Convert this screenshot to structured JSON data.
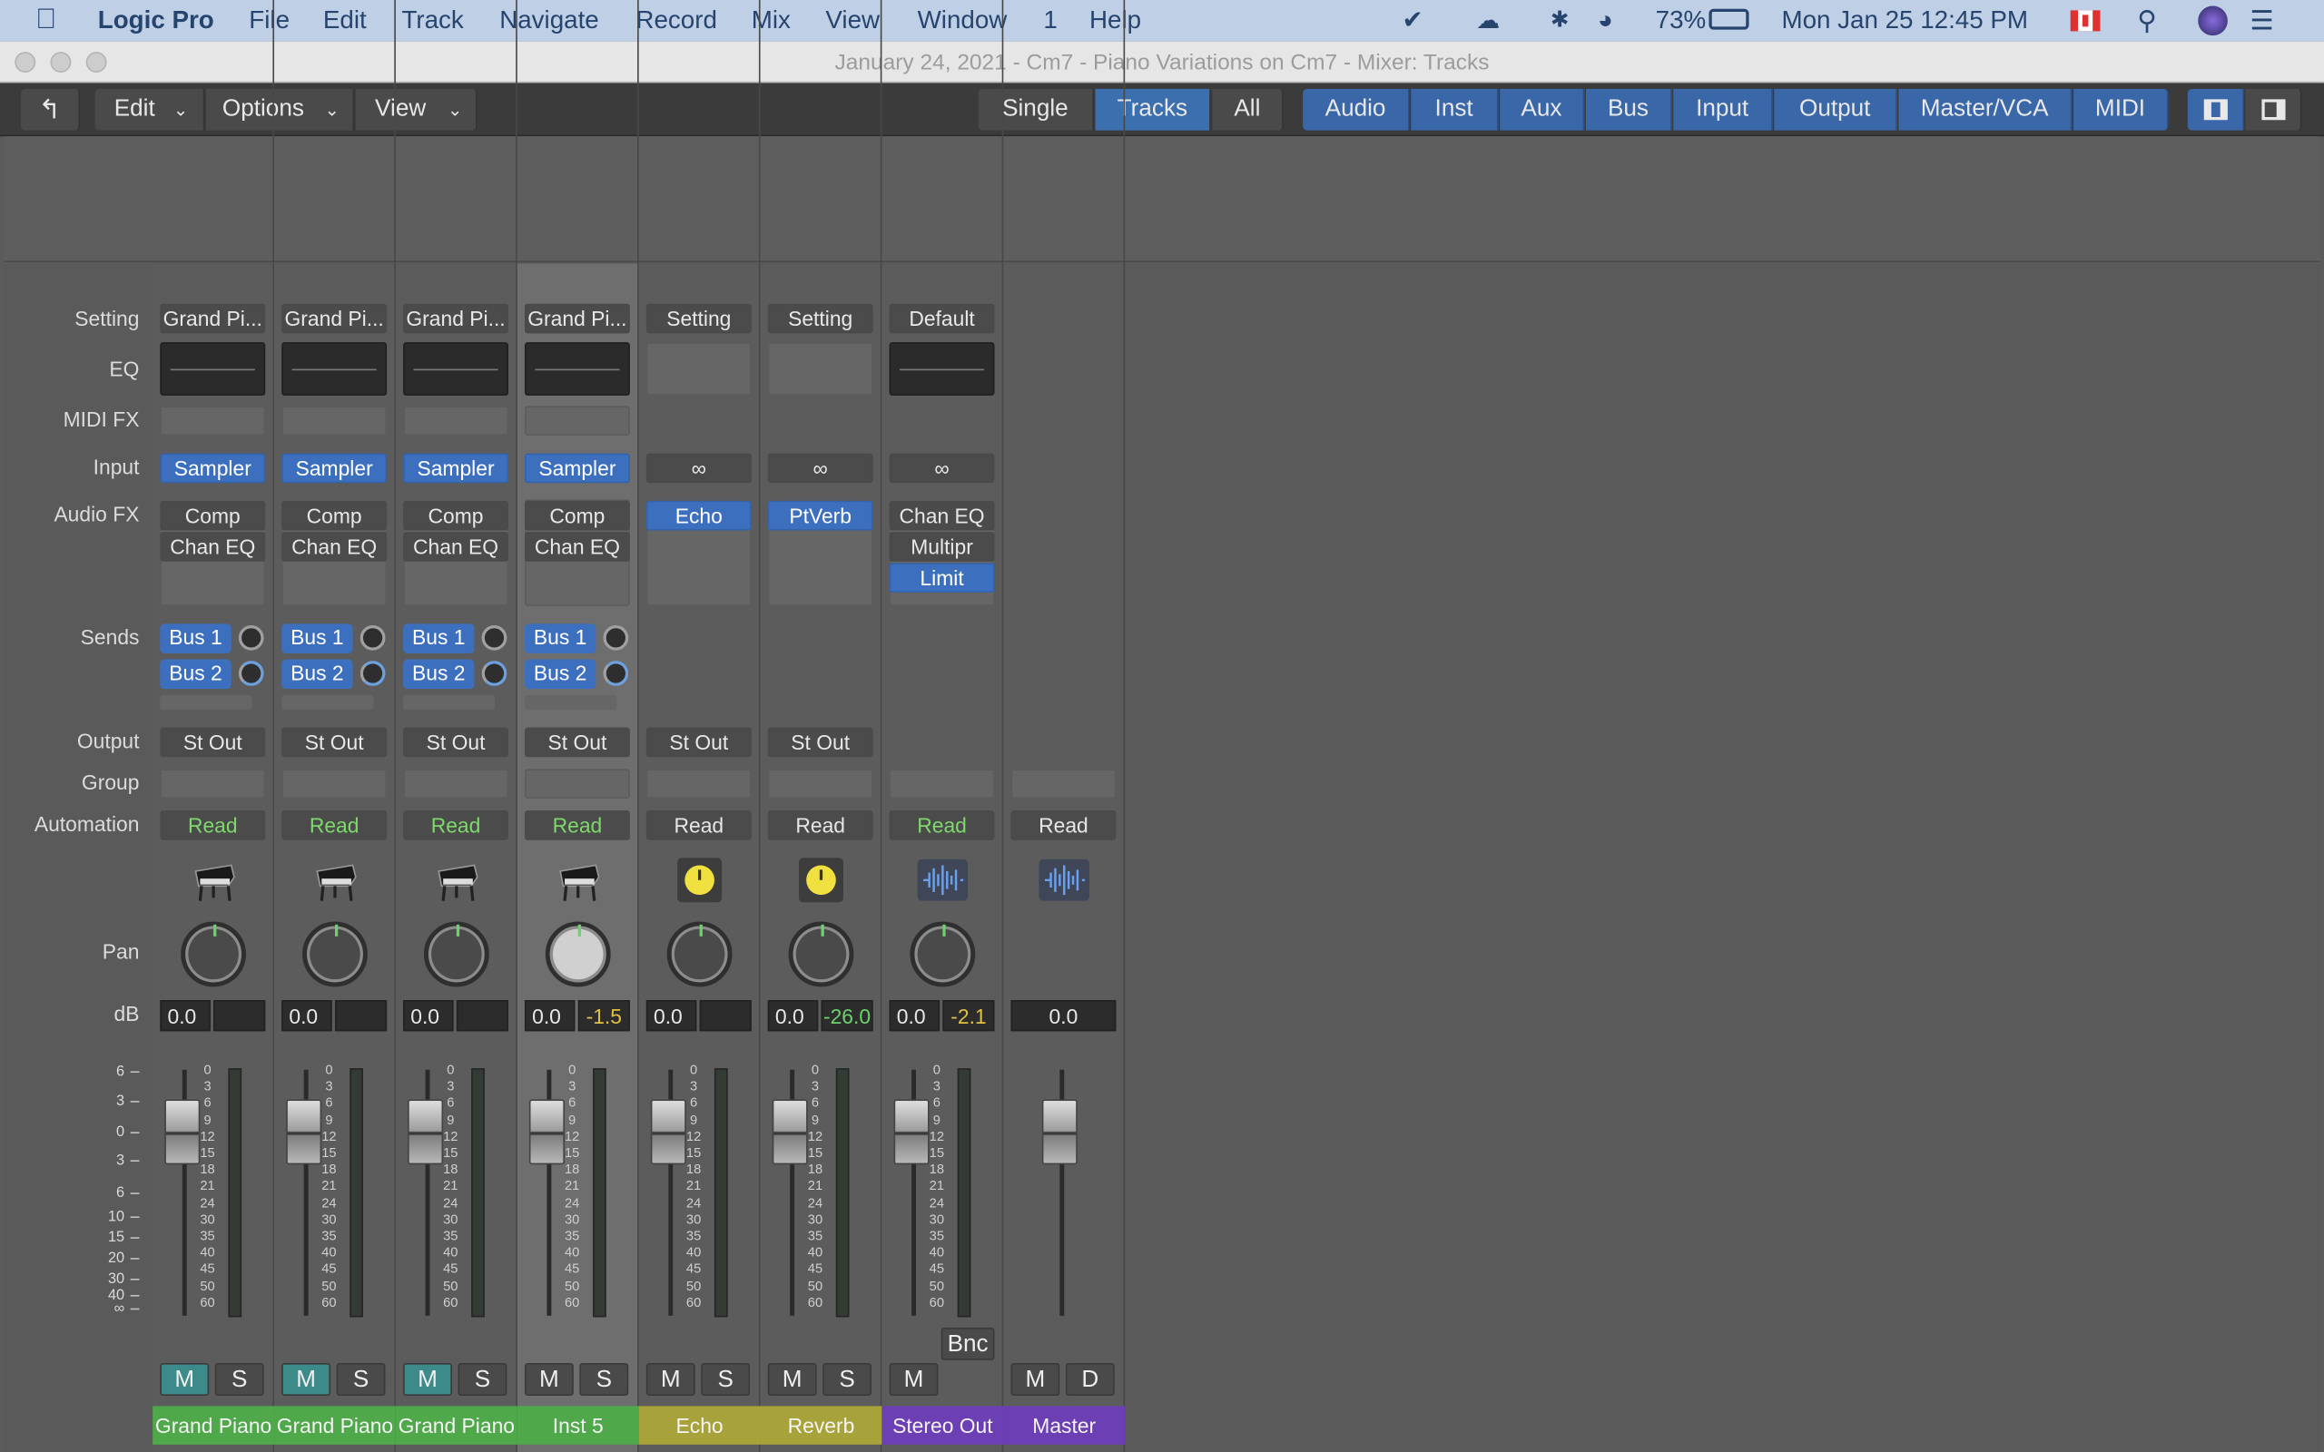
{
  "menubar": {
    "app": "Logic Pro",
    "items": [
      "File",
      "Edit",
      "Track",
      "Navigate",
      "Record",
      "Mix",
      "View",
      "Window",
      "1",
      "Help"
    ],
    "battery": "73%",
    "datetime": "Mon Jan 25  12:45 PM"
  },
  "window": {
    "title": "January 24, 2021 - Cm7 - Piano Variations on Cm7 - Mixer: Tracks"
  },
  "toolbar": {
    "menus": [
      "Edit",
      "Options",
      "View"
    ],
    "view_modes": [
      "Single",
      "Tracks",
      "All"
    ],
    "selected_view": "Tracks",
    "filters": [
      "Audio",
      "Inst",
      "Aux",
      "Bus",
      "Input",
      "Output",
      "Master/VCA",
      "MIDI"
    ]
  },
  "row_labels": {
    "setting": "Setting",
    "eq": "EQ",
    "midifx": "MIDI FX",
    "input": "Input",
    "audiofx": "Audio FX",
    "sends": "Sends",
    "output": "Output",
    "group": "Group",
    "automation": "Automation",
    "pan": "Pan",
    "db": "dB"
  },
  "scale_left": [
    "6",
    "3",
    "0",
    "3",
    "6",
    "10",
    "15",
    "20",
    "30",
    "40",
    "∞"
  ],
  "scale_meter": [
    "0",
    "3",
    "6",
    "9",
    "12",
    "15",
    "18",
    "21",
    "24",
    "30",
    "35",
    "40",
    "45",
    "50",
    "60"
  ],
  "strips": [
    {
      "name": "Grand Piano",
      "setting": "Grand Pi...",
      "input": "Sampler",
      "fx": [
        "Comp",
        "Chan EQ"
      ],
      "sends": [
        "Bus 1",
        "Bus 2"
      ],
      "output": "St Out",
      "automation": "Read",
      "volume": "0.0",
      "peak": "",
      "mute": "M",
      "solo": "S",
      "mute_on": true,
      "color": "#4fa84a",
      "icon": "piano-icon"
    },
    {
      "name": "Grand Piano",
      "setting": "Grand Pi...",
      "input": "Sampler",
      "fx": [
        "Comp",
        "Chan EQ"
      ],
      "sends": [
        "Bus 1",
        "Bus 2"
      ],
      "output": "St Out",
      "automation": "Read",
      "volume": "0.0",
      "peak": "",
      "mute": "M",
      "solo": "S",
      "mute_on": true,
      "color": "#4fa84a",
      "icon": "piano-icon"
    },
    {
      "name": "Grand Piano",
      "setting": "Grand Pi...",
      "input": "Sampler",
      "fx": [
        "Comp",
        "Chan EQ"
      ],
      "sends": [
        "Bus 1",
        "Bus 2"
      ],
      "output": "St Out",
      "automation": "Read",
      "volume": "0.0",
      "peak": "",
      "mute": "M",
      "solo": "S",
      "mute_on": true,
      "color": "#4fa84a",
      "icon": "piano-icon"
    },
    {
      "name": "Inst 5",
      "setting": "Grand Pi...",
      "input": "Sampler",
      "fx": [
        "Comp",
        "Chan EQ"
      ],
      "sends": [
        "Bus 1",
        "Bus 2"
      ],
      "output": "St Out",
      "automation": "Read",
      "volume": "0.0",
      "peak": "-1.5",
      "mute": "M",
      "solo": "S",
      "mute_on": false,
      "color": "#4fa84a",
      "icon": "piano-icon"
    },
    {
      "name": "Echo",
      "setting": "Setting",
      "input": "∞",
      "fx": [
        "Echo"
      ],
      "sends": [],
      "output": "St Out",
      "automation": "Read",
      "volume": "0.0",
      "peak": "",
      "mute": "M",
      "solo": "S",
      "mute_on": false,
      "color": "#a8a23a",
      "icon": "knob-icon"
    },
    {
      "name": "Reverb",
      "setting": "Setting",
      "input": "∞",
      "fx": [
        "PtVerb"
      ],
      "sends": [],
      "output": "St Out",
      "automation": "Read",
      "volume": "0.0",
      "peak": "-26.0",
      "mute": "M",
      "solo": "S",
      "mute_on": false,
      "color": "#a8a23a",
      "icon": "knob-icon"
    },
    {
      "name": "Stereo Out",
      "setting": "Default",
      "input": "∞",
      "fx": [
        "Chan EQ",
        "Multipr",
        "Limit"
      ],
      "sends": [],
      "output": "",
      "automation": "Read",
      "volume": "0.0",
      "peak": "-2.1",
      "mute": "M",
      "solo": "",
      "bounce": "Bnc",
      "mute_on": false,
      "color": "#6d3fb4",
      "icon": "waveform-icon"
    },
    {
      "name": "Master",
      "setting": "",
      "input": "",
      "fx": [],
      "sends": [],
      "output": "",
      "automation": "Read",
      "volume": "0.0",
      "peak": "",
      "mute": "M",
      "solo": "D",
      "mute_on": false,
      "color": "#6d3fb4",
      "icon": "waveform-icon"
    }
  ]
}
